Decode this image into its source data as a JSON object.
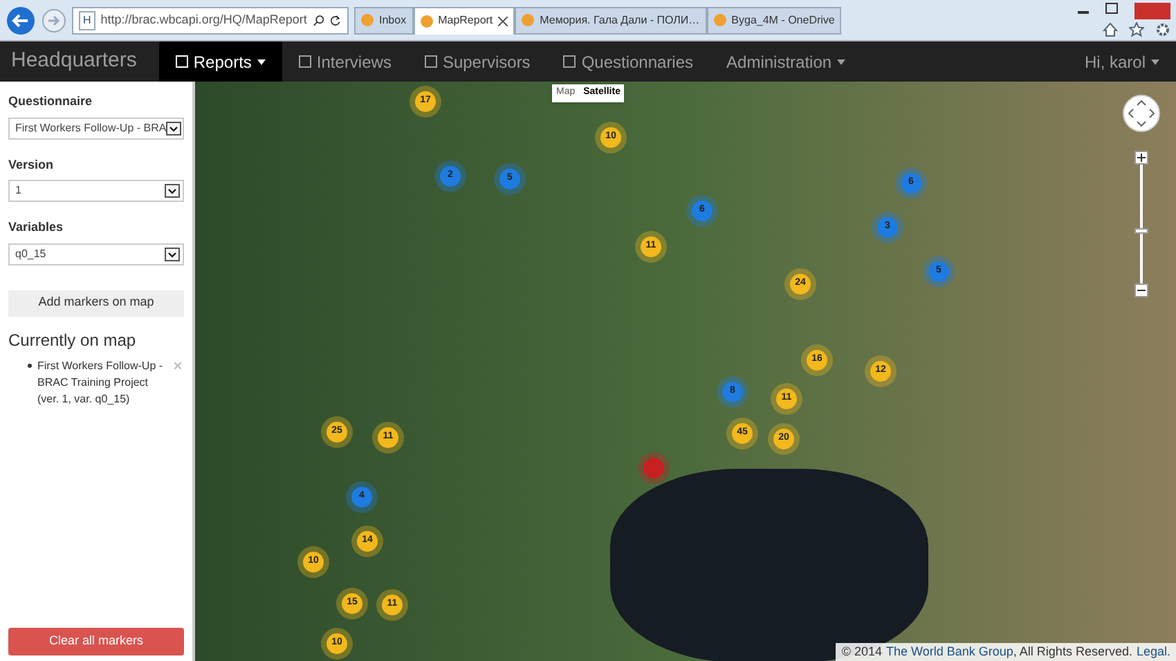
{
  "browser": {
    "favicon": "H",
    "address": "http://brac.wbcapi.org/HQ/MapReport",
    "tabs": [
      {
        "label": "Inbox",
        "selected": false
      },
      {
        "label": "MapReport",
        "selected": true
      },
      {
        "label": "Мемория. Гала Дали - ПОЛИ…",
        "selected": false
      },
      {
        "label": "Byga_4M - OneDrive",
        "selected": false
      }
    ]
  },
  "navbar": {
    "brand": "Headquarters",
    "user": "Hi, karol",
    "items": [
      {
        "label": "Reports",
        "selected": true,
        "dropdown": true
      },
      {
        "label": "Interviews",
        "selected": false,
        "dropdown": false
      },
      {
        "label": "Supervisors",
        "selected": false,
        "dropdown": false
      },
      {
        "label": "Questionnaries",
        "selected": false,
        "dropdown": false
      },
      {
        "label": "Administration",
        "selected": false,
        "dropdown": true
      }
    ]
  },
  "sidebar": {
    "fields": [
      {
        "label": "Questionnaire",
        "value": "First Workers Follow-Up - BRA"
      },
      {
        "label": "Version",
        "value": "1"
      },
      {
        "label": "Variables",
        "value": "q0_15"
      }
    ],
    "add_button": "Add markers on map",
    "current_heading": "Currently on map",
    "current_items": [
      "First Workers Follow-Up - BRAC Training Project (ver. 1, var. q0_15)"
    ],
    "clear_button": "Clear all markers"
  },
  "map": {
    "zoom": {
      "level": 0.44
    },
    "types": [
      {
        "label": "Map",
        "selected": false
      },
      {
        "label": "Satellite",
        "selected": true
      }
    ],
    "markers": [
      {
        "count": "17",
        "color": "#f2b81c"
      },
      {
        "count": "10",
        "color": "#f2b81c"
      },
      {
        "count": "2",
        "color": "#1e7be0"
      },
      {
        "count": "5",
        "color": "#1e7be0"
      },
      {
        "count": "6",
        "color": "#1e7be0"
      },
      {
        "count": "11",
        "color": "#f2b81c"
      },
      {
        "count": "6",
        "color": "#1e7be0"
      },
      {
        "count": "3",
        "color": "#1e7be0"
      },
      {
        "count": "5",
        "color": "#1e7be0"
      },
      {
        "count": "24",
        "color": "#f2b81c"
      },
      {
        "count": "16",
        "color": "#f2b81c"
      },
      {
        "count": "12",
        "color": "#f2b81c"
      },
      {
        "count": "8",
        "color": "#1e7be0"
      },
      {
        "count": "11",
        "color": "#f2b81c"
      },
      {
        "count": "45",
        "color": "#f2b81c"
      },
      {
        "count": "20",
        "color": "#f2b81c"
      },
      {
        "count": "25",
        "color": "#f2b81c"
      },
      {
        "count": "11",
        "color": "#f2b81c"
      },
      {
        "color": "#c62020"
      },
      {
        "count": "4",
        "color": "#1e7be0"
      },
      {
        "count": "14",
        "color": "#f2b81c"
      },
      {
        "count": "10",
        "color": "#f2b81c"
      },
      {
        "count": "15",
        "color": "#f2b81c"
      },
      {
        "count": "11",
        "color": "#f2b81c"
      },
      {
        "count": "10",
        "color": "#f2b81c"
      }
    ],
    "copyright": "© 2014",
    "copyright_link": "The World Bank Group",
    "rights": ", All Rights Reserved.",
    "legal": "Legal."
  }
}
